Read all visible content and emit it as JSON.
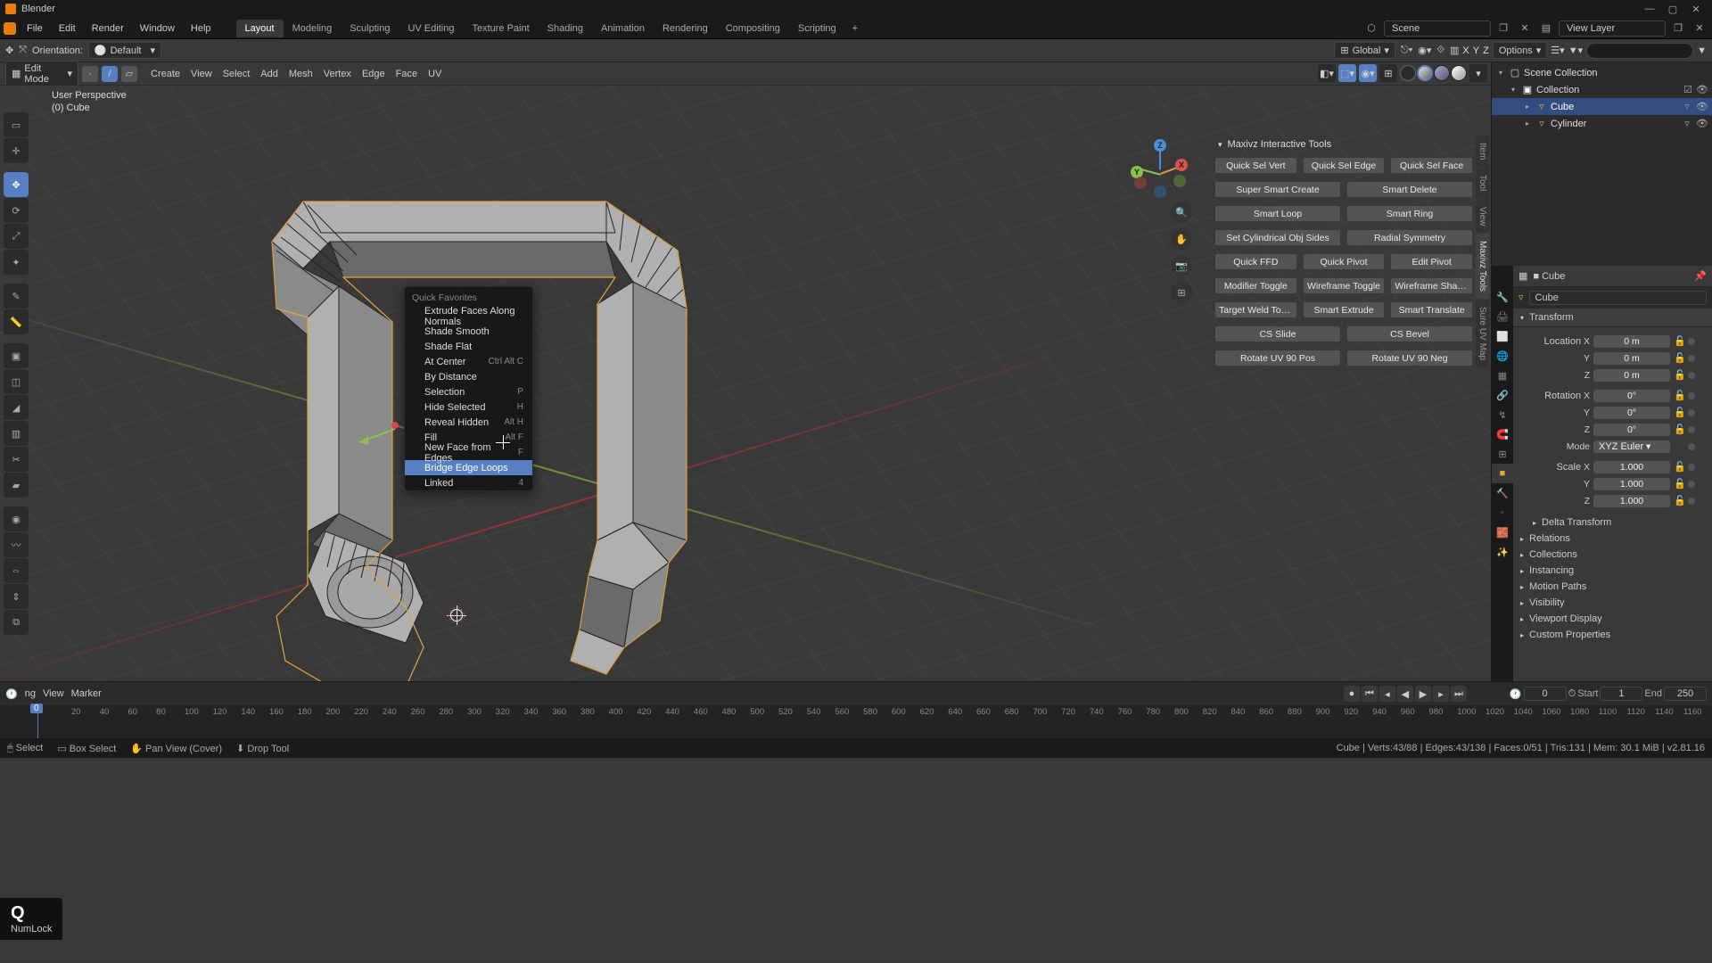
{
  "app": {
    "title": "Blender"
  },
  "menubar": {
    "items": [
      "File",
      "Edit",
      "Render",
      "Window",
      "Help"
    ],
    "tabs": [
      "Layout",
      "Modeling",
      "Sculpting",
      "UV Editing",
      "Texture Paint",
      "Shading",
      "Animation",
      "Rendering",
      "Compositing",
      "Scripting"
    ],
    "scene_label": "Scene",
    "viewlayer_label": "View Layer"
  },
  "header2": {
    "orientation_label": "Orientation:",
    "orientation_value": "Default",
    "global_label": "Global",
    "xyz": [
      "X",
      "Y",
      "Z"
    ],
    "options": "Options"
  },
  "editbar": {
    "mode": "Edit Mode",
    "menus": [
      "Create",
      "View",
      "Select",
      "Add",
      "Mesh",
      "Vertex",
      "Edge",
      "Face",
      "UV"
    ]
  },
  "overlay": {
    "line1": "User Perspective",
    "line2": "(0) Cube"
  },
  "maxivz": {
    "title": "Maxivz Interactive Tools",
    "row1": [
      "Quick Sel Vert",
      "Quick Sel Edge",
      "Quick Sel Face"
    ],
    "rows": [
      [
        "Super Smart Create",
        "Smart Delete"
      ],
      [
        "Smart Loop",
        "Smart Ring"
      ],
      [
        "Set Cylindrical Obj Sides",
        "Radial Symmetry"
      ],
      [
        "Quick FFD",
        "Quick Pivot",
        "Edit Pivot"
      ],
      [
        "Modifier Toggle",
        "Wireframe Toggle",
        "Wireframe Shaded To.."
      ],
      [
        "Target Weld Toggle",
        "Smart Extrude",
        "Smart Translate"
      ],
      [
        "CS Slide",
        "CS Bevel"
      ],
      [
        "Rotate UV 90 Pos",
        "Rotate UV 90 Neg"
      ]
    ]
  },
  "side_tabs": [
    "Item",
    "Tool",
    "View",
    "Maxivz Tools",
    "Sure UV Map"
  ],
  "quick_fav": {
    "title": "Quick Favorites",
    "items": [
      {
        "label": "Extrude Faces Along Normals",
        "sc": ""
      },
      {
        "label": "Shade Smooth",
        "sc": ""
      },
      {
        "label": "Shade Flat",
        "sc": ""
      },
      {
        "label": "At Center",
        "sc": "Ctrl Alt C"
      },
      {
        "label": "By Distance",
        "sc": ""
      },
      {
        "label": "Selection",
        "sc": "P"
      },
      {
        "label": "Hide Selected",
        "sc": "H"
      },
      {
        "label": "Reveal Hidden",
        "sc": "Alt H"
      },
      {
        "label": "Fill",
        "sc": "Alt F"
      },
      {
        "label": "New Face from Edges",
        "sc": "F"
      },
      {
        "label": "Bridge Edge Loops",
        "sc": ""
      },
      {
        "label": "Linked",
        "sc": "4"
      }
    ],
    "hover_index": 10
  },
  "outliner": {
    "collection": "Scene Collection",
    "coll_name": "Collection",
    "items": [
      {
        "name": "Cube",
        "selected": true
      },
      {
        "name": "Cylinder",
        "selected": false
      }
    ]
  },
  "props": {
    "breadcrumb": "Cube",
    "obj_name": "Cube",
    "transform_label": "Transform",
    "loc": {
      "label": "Location",
      "x": "0 m",
      "y": "0 m",
      "z": "0 m"
    },
    "rot": {
      "label": "Rotation",
      "x": "0°",
      "y": "0°",
      "z": "0°"
    },
    "mode_label": "Mode",
    "mode_value": "XYZ Euler",
    "scale": {
      "label": "Scale",
      "x": "1.000",
      "y": "1.000",
      "z": "1.000"
    },
    "panels": [
      "Delta Transform",
      "Relations",
      "Collections",
      "Instancing",
      "Motion Paths",
      "Visibility",
      "Viewport Display",
      "Custom Properties"
    ]
  },
  "timeline": {
    "menus": [
      "ng",
      "View",
      "Marker"
    ],
    "current": "0",
    "start_label": "Start",
    "start": "1",
    "end_label": "End",
    "end": "250",
    "ticks": [
      "20",
      "40",
      "60",
      "80",
      "100",
      "120",
      "140",
      "160",
      "180",
      "200",
      "220",
      "240",
      "260",
      "280",
      "300",
      "320",
      "340",
      "360",
      "380",
      "400",
      "420",
      "440",
      "460",
      "480",
      "500",
      "520",
      "540",
      "560",
      "580",
      "600",
      "620",
      "640",
      "660",
      "680",
      "700",
      "720",
      "740",
      "760",
      "780",
      "800",
      "820",
      "840",
      "860",
      "880",
      "900",
      "920",
      "940",
      "960",
      "980",
      "1000",
      "1020",
      "1040",
      "1060",
      "1080",
      "1100",
      "1120",
      "1140",
      "1160"
    ]
  },
  "status": {
    "select": "Select",
    "box": "Box Select",
    "pan": "Pan View (Cover)",
    "drop": "Drop Tool",
    "right": "Cube | Verts:43/88 | Edges:43/138 | Faces:0/51 | Tris:131 | Mem: 30.1 MiB | v2.81.16"
  },
  "key_overlay": {
    "key": "Q",
    "lock": "NumLock"
  }
}
